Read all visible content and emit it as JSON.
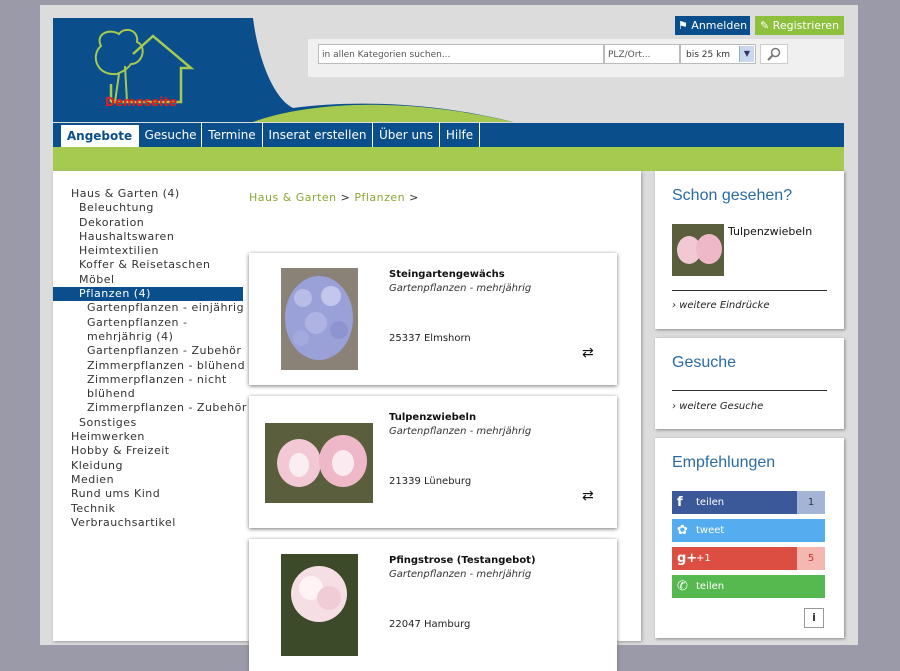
{
  "header": {
    "logo_text": "Demoseite",
    "login_label": "Anmelden",
    "register_label": "Registrieren",
    "search": {
      "category_placeholder": "in allen Kategorien suchen...",
      "plz_placeholder": "PLZ/Ort...",
      "radius_value": "bis 25 km"
    }
  },
  "nav": {
    "items": [
      "Angebote",
      "Gesuche",
      "Termine",
      "Inserat erstellen",
      "Über uns",
      "Hilfe"
    ]
  },
  "categories": [
    "Haus & Garten (4)",
    "Beleuchtung",
    "Dekoration",
    "Haushaltswaren",
    "Heimtextilien",
    "Koffer & Reisetaschen",
    "Möbel",
    "Pflanzen (4)",
    "Gartenpflanzen - einjährig",
    "Gartenpflanzen -",
    "mehrjährig (4)",
    "Gartenpflanzen - Zubehör",
    "Zimmerpflanzen - blühend",
    "Zimmerpflanzen - nicht",
    "blühend",
    "Zimmerpflanzen - Zubehör",
    "Sonstiges",
    "Heimwerken",
    "Hobby & Freizeit",
    "Kleidung",
    "Medien",
    "Rund ums Kind",
    "Technik",
    "Verbrauchsartikel"
  ],
  "breadcrumb": {
    "part1": "Haus & Garten",
    "sep1": ">",
    "part2": "Pflanzen",
    "sep2": ">"
  },
  "listings": [
    {
      "title": "Steingartengewächs",
      "category": "Gartenpflanzen - mehrjährig",
      "location": "25337 Elmshorn"
    },
    {
      "title": "Tulpenzwiebeln",
      "category": "Gartenpflanzen - mehrjährig",
      "location": "21339 Lüneburg"
    },
    {
      "title": "Pfingstrose (Testangebot)",
      "category": "Gartenpflanzen - mehrjährig",
      "location": "22047 Hamburg"
    }
  ],
  "sidebar": {
    "seen": {
      "title": "Schon gesehen?",
      "item": "Tulpenzwiebeln",
      "more": "weitere Eindrücke"
    },
    "requests": {
      "title": "Gesuche",
      "more": "weitere Gesuche"
    },
    "recommend": {
      "title": "Empfehlungen",
      "facebook": {
        "label": "teilen",
        "count": "1",
        "color": "#3b5998"
      },
      "twitter": {
        "label": "tweet",
        "color": "#55acee"
      },
      "gplus": {
        "label": "+1",
        "count": "5",
        "color": "#dc4e41"
      },
      "whatsapp": {
        "label": "teilen",
        "color": "#56b94f"
      },
      "info_icon": "i"
    }
  }
}
